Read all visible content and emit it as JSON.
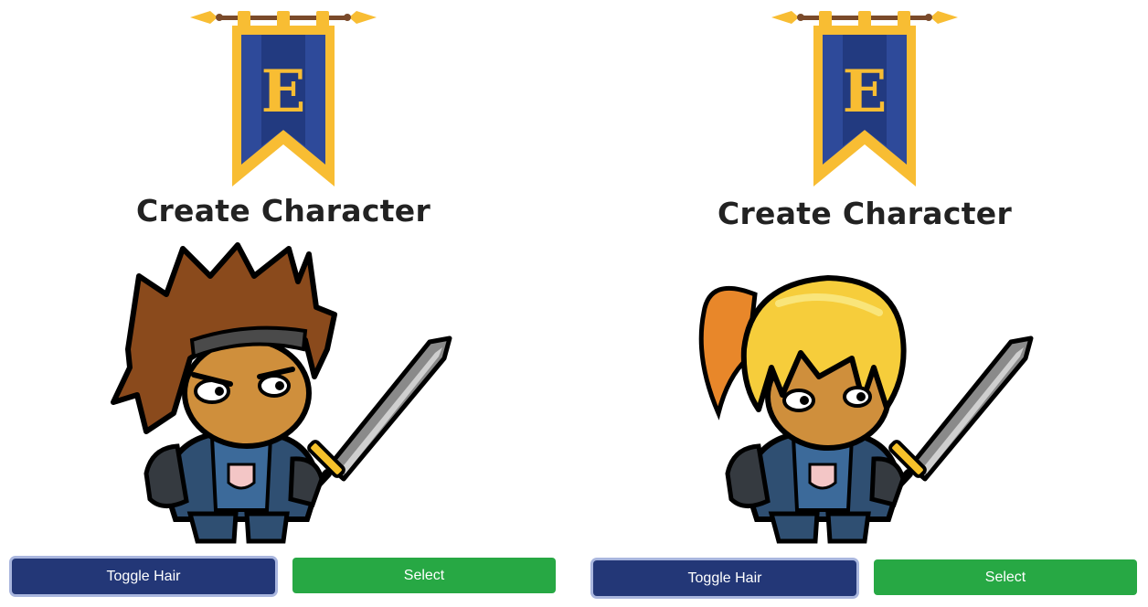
{
  "panels": [
    {
      "id": "left",
      "banner_letter": "E",
      "title": "Create Character",
      "hair_style": "spiky-brown",
      "toggle_label": "Toggle Hair",
      "select_label": "Select"
    },
    {
      "id": "right",
      "banner_letter": "E",
      "title": "Create Character",
      "hair_style": "blonde-ponytail",
      "toggle_label": "Toggle Hair",
      "select_label": "Select"
    }
  ],
  "colors": {
    "banner_blue": "#2e4a9a",
    "banner_gold": "#f8bd33",
    "toggle_button": "#233777",
    "select_button": "#27a844",
    "brown_hair": "#8a4a1c",
    "blonde_hair": "#f6cd3b"
  }
}
